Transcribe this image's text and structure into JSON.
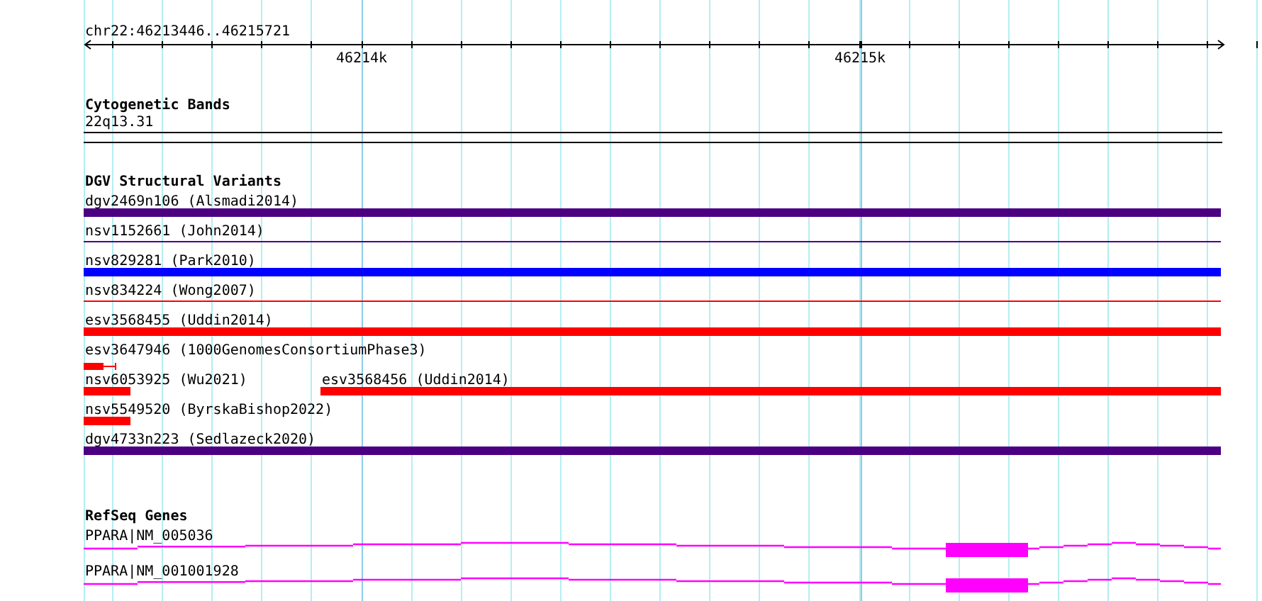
{
  "ruler": {
    "location": "chr22:46213446..46215721",
    "tick_labels": [
      "46214k",
      "46215k"
    ]
  },
  "cytoband_track": {
    "title": "Cytogenetic Bands",
    "band": "22q13.31"
  },
  "variant_track": {
    "title": "DGV Structural Variants",
    "rows": [
      [
        {
          "label": "dgv2469n106 (Alsmadi2014)",
          "kind": "bar",
          "color": "#4b0082"
        }
      ],
      [
        {
          "label": "nsv1152661 (John2014)",
          "kind": "line",
          "color": "#4b0082"
        }
      ],
      [
        {
          "label": "nsv829281 (Park2010)",
          "kind": "bar",
          "color": "#0000ff"
        }
      ],
      [
        {
          "label": "nsv834224 (Wong2007)",
          "kind": "line",
          "color": "#ff0000"
        }
      ],
      [
        {
          "label": "esv3568455 (Uddin2014)",
          "kind": "bar",
          "color": "#ff0000"
        }
      ],
      [
        {
          "label": "esv3647946 (1000GenomesConsortiumPhase3)",
          "kind": "whisker",
          "color": "#ff0000"
        }
      ],
      [
        {
          "label": "nsv6053925 (Wu2021)",
          "kind": "bar",
          "color": "#ff0000"
        },
        {
          "label": "esv3568456 (Uddin2014)",
          "kind": "bar",
          "color": "#ff0000"
        }
      ],
      [
        {
          "label": "nsv5549520 (ByrskaBishop2022)",
          "kind": "bar",
          "color": "#ff0000"
        }
      ],
      [
        {
          "label": "dgv4733n223 (Sedlazeck2020)",
          "kind": "bar",
          "color": "#4b0082"
        }
      ]
    ]
  },
  "gene_track": {
    "title": "RefSeq Genes",
    "genes": [
      {
        "label": "PPARA|NM_005036",
        "color": "#ff00ff"
      },
      {
        "label": "PPARA|NM_001001928",
        "color": "#ff00ff"
      }
    ]
  }
}
